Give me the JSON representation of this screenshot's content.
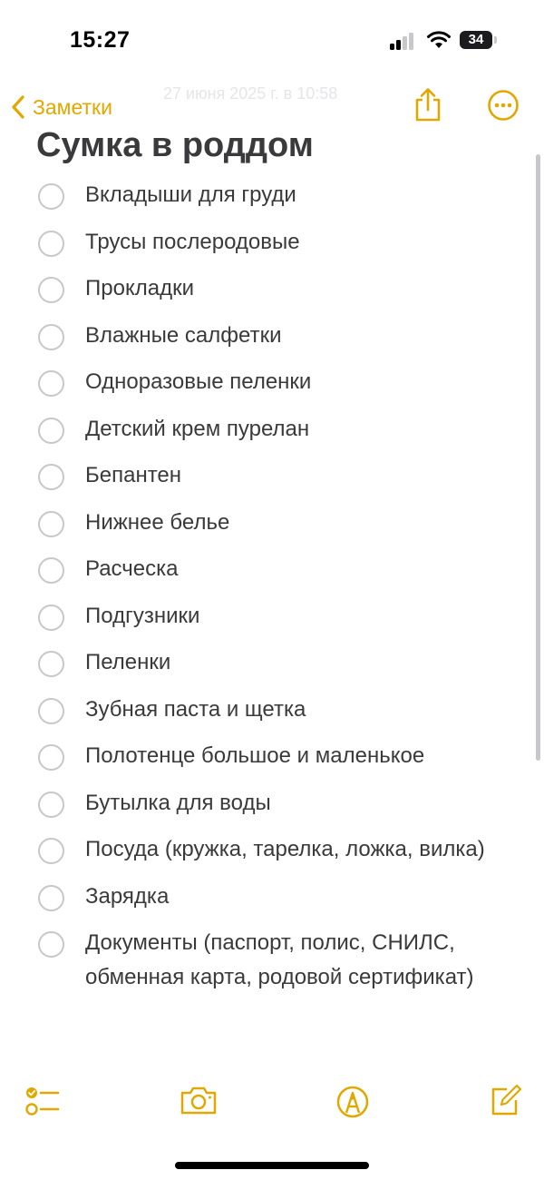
{
  "status_bar": {
    "time": "15:27",
    "battery": "34"
  },
  "nav": {
    "back_label": "Заметки",
    "date_text": "27 июня 2025 г. в 10:58"
  },
  "note": {
    "title": "Сумка в роддом",
    "items": [
      {
        "text": "Вкладыши для груди",
        "checked": false
      },
      {
        "text": "Трусы послеродовые",
        "checked": false
      },
      {
        "text": "Прокладки",
        "checked": false
      },
      {
        "text": "Влажные салфетки",
        "checked": false
      },
      {
        "text": "Одноразовые пеленки",
        "checked": false
      },
      {
        "text": "Детский крем пурелан",
        "checked": false
      },
      {
        "text": "Бепантен",
        "checked": false
      },
      {
        "text": "Нижнее белье",
        "checked": false
      },
      {
        "text": "Расческа",
        "checked": false
      },
      {
        "text": "Подгузники",
        "checked": false
      },
      {
        "text": "Пеленки",
        "checked": false
      },
      {
        "text": "Зубная паста и щетка",
        "checked": false
      },
      {
        "text": "Полотенце большое и маленькое",
        "checked": false
      },
      {
        "text": "Бутылка для воды",
        "checked": false
      },
      {
        "text": "Посуда (кружка, тарелка, ложка, вилка)",
        "checked": false
      },
      {
        "text": "Зарядка",
        "checked": false
      },
      {
        "text": "Документы (паспорт, полис, СНИЛС, обменная карта, родовой сертификат)",
        "checked": false
      }
    ]
  },
  "icons": {
    "back": "chevron-left-icon",
    "share": "share-icon",
    "more": "more-icon",
    "checklist": "checklist-icon",
    "camera": "camera-icon",
    "markup": "markup-pen-icon",
    "compose": "compose-icon"
  },
  "colors": {
    "accent": "#E0A800",
    "text": "#3A3A3C",
    "circle": "#C7C7CC",
    "background": "#FFFFFF"
  }
}
